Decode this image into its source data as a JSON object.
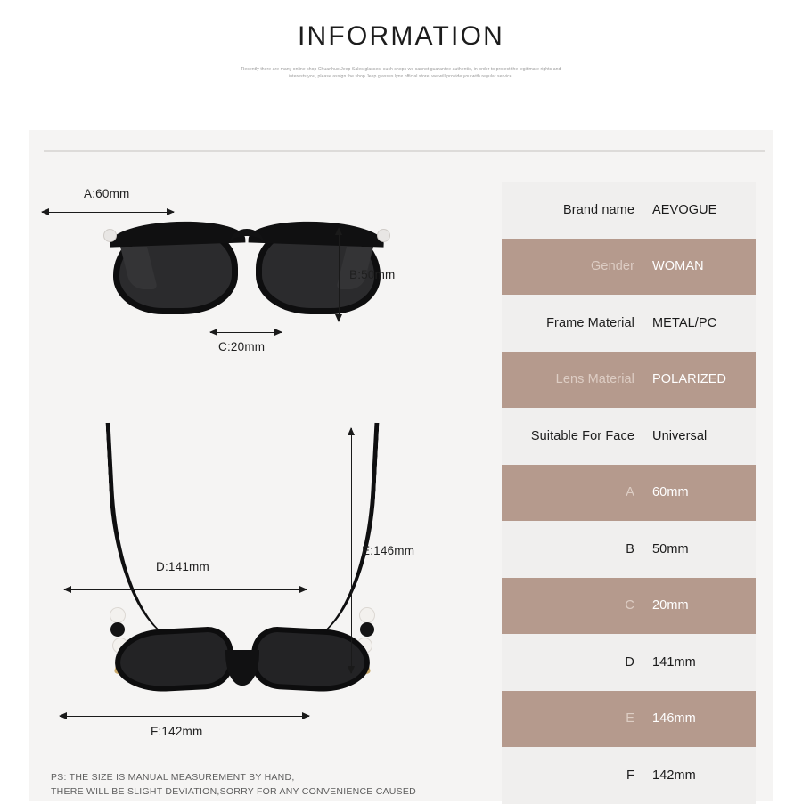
{
  "header": {
    "title": "INFORMATION",
    "description": "Recently there are many online shop Chuanhuo Jeep Sales glasses, such shops we cannot guarantee authentic, in order to protect the legitimate rights and interests you, please assign the shop Jeep glasses lynx official store, we will provide you with regular service."
  },
  "diagram": {
    "front_view": {
      "width_label": "A:60mm",
      "height_label": "B:50mm",
      "bridge_label": "C:20mm"
    },
    "top_view": {
      "temple_spread_label": "D:141mm",
      "temple_length_label": "E:146mm",
      "frame_width_label": "F:142mm"
    }
  },
  "footnote": {
    "line1": "PS: THE SIZE IS MANUAL MEASUREMENT BY HAND,",
    "line2": "THERE WILL BE SLIGHT DEVIATION,SORRY FOR ANY CONVENIENCE CAUSED"
  },
  "colors": {
    "accent": "#b59a8d",
    "light_row": "#f0efee",
    "panel": "#f5f4f3",
    "accent_label_text": "#ddcdc4"
  },
  "spec_table": {
    "rows": [
      {
        "label": "Brand name",
        "value": "AEVOGUE",
        "style": "light"
      },
      {
        "label": "Gender",
        "value": "WOMAN",
        "style": "accent"
      },
      {
        "label": "Frame Material",
        "value": "METAL/PC",
        "style": "light"
      },
      {
        "label": "Lens Material",
        "value": "POLARIZED",
        "style": "accent"
      },
      {
        "label": "Suitable For Face",
        "value": "Universal",
        "style": "light"
      },
      {
        "label": "A",
        "value": "60mm",
        "style": "accent"
      },
      {
        "label": "B",
        "value": "50mm",
        "style": "light"
      },
      {
        "label": "C",
        "value": "20mm",
        "style": "accent"
      },
      {
        "label": "D",
        "value": "141mm",
        "style": "light"
      },
      {
        "label": "E",
        "value": "146mm",
        "style": "accent"
      },
      {
        "label": "F",
        "value": "142mm",
        "style": "light"
      }
    ]
  }
}
